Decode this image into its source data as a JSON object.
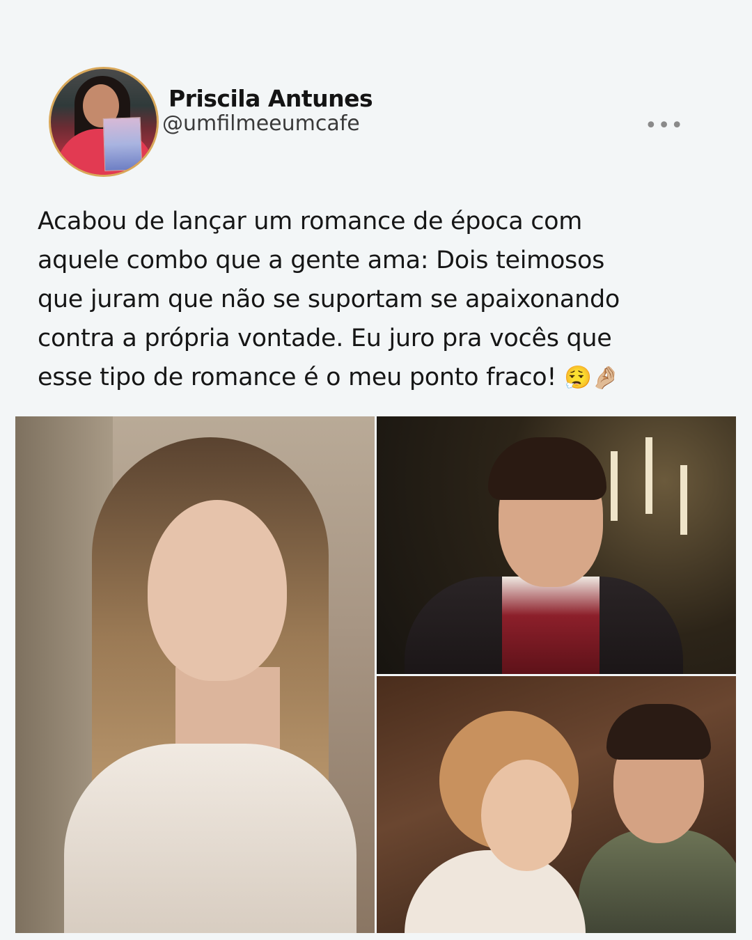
{
  "author": {
    "name": "Priscila Antunes",
    "handle": "@umfilmeeumcafe",
    "avatar_icon": "profile-photo-icon"
  },
  "more_button": {
    "label": "•••",
    "icon": "more-horizontal-icon"
  },
  "post": {
    "lines": [
      "Acabou de lançar um romance de época com",
      "aquele combo que a gente ama: Dois teimosos",
      "que juram que não se suportam se apaixonando",
      "contra a própria vontade. Eu juro pra vocês que",
      "esse tipo de romance é o meu ponto fraco!"
    ],
    "emojis": "😮‍💨🤌🏼"
  },
  "media": [
    {
      "icon": "photo-woman-portrait"
    },
    {
      "icon": "photo-man-period-costume"
    },
    {
      "icon": "photo-couple-period-scene"
    }
  ],
  "colors": {
    "background": "#f3f6f7",
    "text": "#161616",
    "handle": "#3a3a3a",
    "avatar_border": "#d9a85a"
  }
}
